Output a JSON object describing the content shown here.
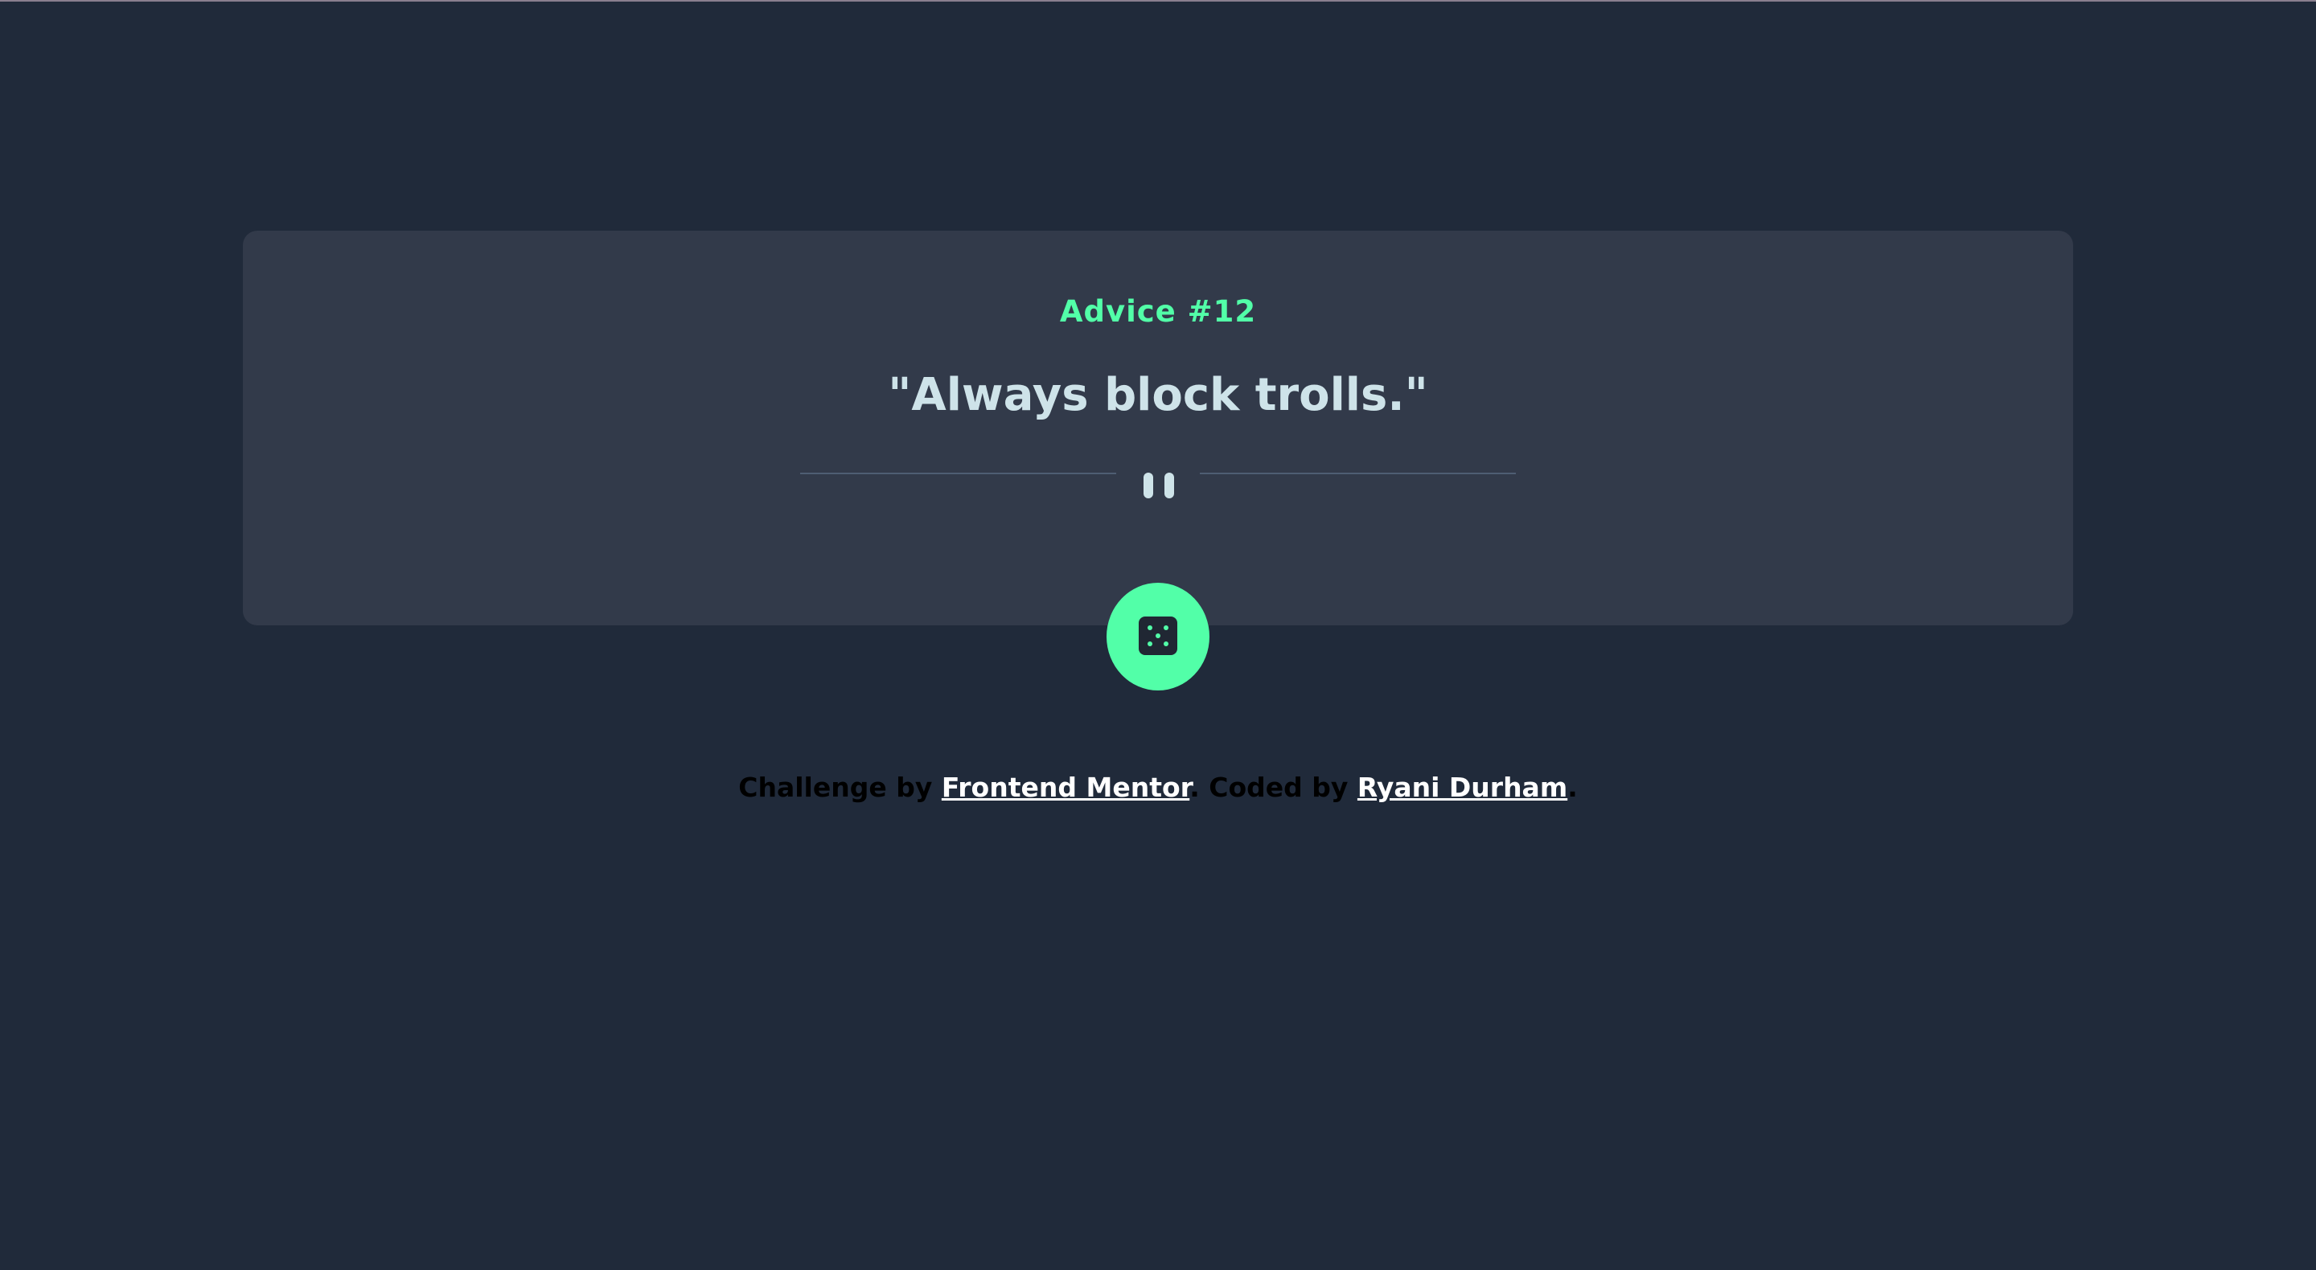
{
  "advice": {
    "title": "Advice #12",
    "quote": "\"Always block trolls.\""
  },
  "icons": {
    "divider": "pause-icon",
    "button": "dice-icon"
  },
  "footer": {
    "challenge_prefix": "Challenge by",
    "challenge_link": "Frontend Mentor",
    "separator": ".",
    "coded_prefix": "Coded by",
    "coded_link": "Ryani Durham",
    "end": "."
  },
  "colors": {
    "background": "#202a3a",
    "card": "#323a4a",
    "accent": "#52ffa8",
    "quote": "#cee3e9",
    "divider": "#4e5d73",
    "link": "#ffffff",
    "footer_text": "#000000"
  }
}
